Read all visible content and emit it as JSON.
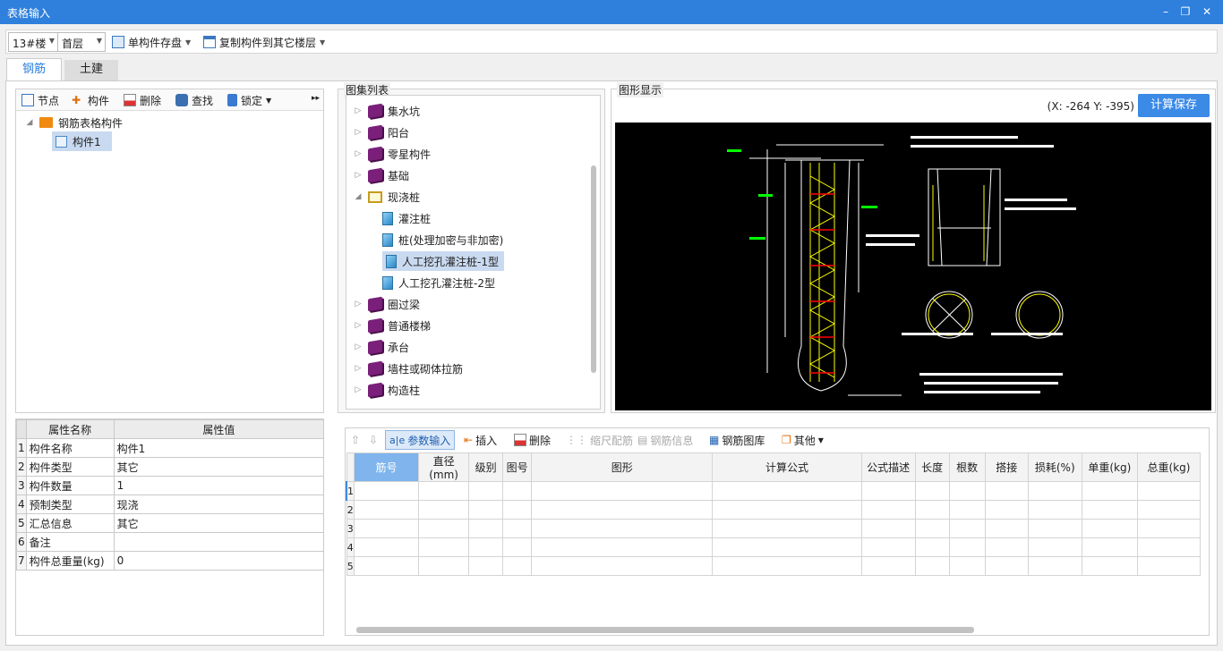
{
  "window": {
    "title": "表格输入"
  },
  "toolbar": {
    "building": "13#楼",
    "floor": "首层",
    "save_single": "单构件存盘",
    "copy_to_floors": "复制构件到其它楼层"
  },
  "tabs": [
    {
      "label": "钢筋",
      "active": true
    },
    {
      "label": "土建",
      "active": false
    }
  ],
  "tree_toolbar": {
    "node": "节点",
    "component": "构件",
    "delete": "删除",
    "find": "查找",
    "lock": "锁定"
  },
  "tree": {
    "root": "钢筋表格构件",
    "children": [
      "构件1"
    ],
    "selected": "构件1"
  },
  "properties": {
    "headers": [
      "属性名称",
      "属性值"
    ],
    "rows": [
      {
        "no": "1",
        "name": "构件名称",
        "value": "构件1"
      },
      {
        "no": "2",
        "name": "构件类型",
        "value": "其它"
      },
      {
        "no": "3",
        "name": "构件数量",
        "value": "1"
      },
      {
        "no": "4",
        "name": "预制类型",
        "value": "现浇"
      },
      {
        "no": "5",
        "name": "汇总信息",
        "value": "其它"
      },
      {
        "no": "6",
        "name": "备注",
        "value": ""
      },
      {
        "no": "7",
        "name": "构件总重量(kg)",
        "value": "0"
      }
    ]
  },
  "atlas": {
    "title": "图集列表",
    "items": [
      {
        "label": "集水坑",
        "type": "book"
      },
      {
        "label": "阳台",
        "type": "book"
      },
      {
        "label": "零星构件",
        "type": "book"
      },
      {
        "label": "基础",
        "type": "book"
      },
      {
        "label": "现浇桩",
        "type": "book-open",
        "expanded": true
      },
      {
        "label": "灌注桩",
        "type": "doc",
        "child": true
      },
      {
        "label": "桩(处理加密与非加密)",
        "type": "doc",
        "child": true
      },
      {
        "label": "人工挖孔灌注桩-1型",
        "type": "doc",
        "child": true,
        "selected": true
      },
      {
        "label": "人工挖孔灌注桩-2型",
        "type": "doc",
        "child": true
      },
      {
        "label": "圈过梁",
        "type": "book"
      },
      {
        "label": "普通楼梯",
        "type": "book"
      },
      {
        "label": "承台",
        "type": "book"
      },
      {
        "label": "墙柱或砌体拉筋",
        "type": "book"
      },
      {
        "label": "构造柱",
        "type": "book"
      }
    ]
  },
  "graphic": {
    "title": "图形显示",
    "coords": "(X: -264 Y: -395)",
    "calc_save": "计算保存"
  },
  "grid_toolbar": {
    "param_input": "参数输入",
    "insert": "插入",
    "delete": "删除",
    "scale_rebar": "缩尺配筋",
    "rebar_info": "钢筋信息",
    "rebar_library": "钢筋图库",
    "other": "其他"
  },
  "grid": {
    "headers": [
      "筋号",
      "直径(mm)",
      "级别",
      "图号",
      "图形",
      "计算公式",
      "公式描述",
      "长度",
      "根数",
      "搭接",
      "损耗(%)",
      "单重(kg)",
      "总重(kg)"
    ],
    "row_numbers": [
      "1",
      "2",
      "3",
      "4",
      "5"
    ]
  },
  "colors": {
    "accent": "#2e80dc",
    "selected": "#c9daf0",
    "header_active": "#7fb4ec"
  }
}
